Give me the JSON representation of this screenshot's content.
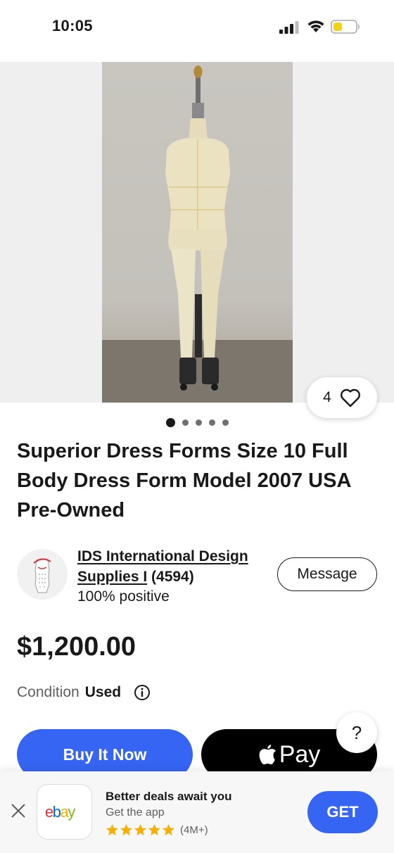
{
  "status_bar": {
    "time": "10:05"
  },
  "gallery": {
    "watch_count": "4",
    "total_images": 5,
    "active_index": 0
  },
  "listing": {
    "title": "Superior Dress Forms Size 10 Full Body Dress Form Model 2007 USA Pre-Owned",
    "price": "$1,200.00",
    "condition_label": "Condition",
    "condition_value": "Used"
  },
  "seller": {
    "name": "IDS International Design Supplies I",
    "feedback_count": "(4594)",
    "positive": "100% positive",
    "message_label": "Message"
  },
  "actions": {
    "buy_now_label": "Buy It Now",
    "apple_pay_label": "Pay",
    "help_label": "?"
  },
  "app_banner": {
    "heading": "Better deals await you",
    "subheading": "Get the app",
    "rating_count": "(4M+)",
    "stars": 5,
    "get_label": "GET"
  },
  "colors": {
    "primary_blue": "#3665f3",
    "text": "#191919",
    "star": "#f5af02"
  }
}
